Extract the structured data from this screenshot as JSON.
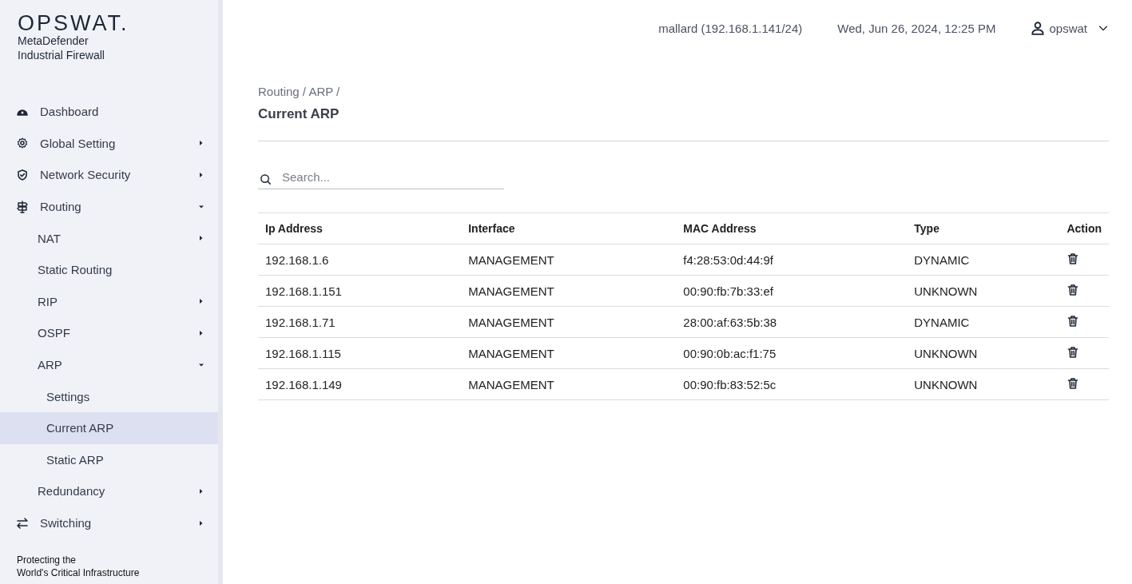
{
  "brand": {
    "logo": "OPSWAT.",
    "product": "MetaDefender",
    "subtitle": "Industrial Firewall"
  },
  "sidebar": {
    "items": [
      {
        "label": "Dashboard",
        "selected": false
      },
      {
        "label": "Global Setting",
        "selected": false,
        "expanded": false
      },
      {
        "label": "Network Security",
        "selected": false,
        "expanded": false
      },
      {
        "label": "Routing",
        "selected": false,
        "expanded": true,
        "children": [
          {
            "label": "NAT",
            "selected": false,
            "expanded": false
          },
          {
            "label": "Static Routing",
            "selected": false
          },
          {
            "label": "RIP",
            "selected": false,
            "expanded": false
          },
          {
            "label": "OSPF",
            "selected": false,
            "expanded": false
          },
          {
            "label": "ARP",
            "selected": false,
            "expanded": true,
            "children": [
              {
                "label": "Settings",
                "selected": false
              },
              {
                "label": "Current ARP",
                "selected": true
              },
              {
                "label": "Static ARP",
                "selected": false
              }
            ]
          },
          {
            "label": "Redundancy",
            "selected": false,
            "expanded": false
          }
        ]
      },
      {
        "label": "Switching",
        "selected": false,
        "expanded": false
      }
    ],
    "footer": [
      "Protecting the",
      "World's Critical Infrastructure"
    ]
  },
  "header": {
    "host": "mallard (192.168.1.141/24)",
    "datetime": "Wed, Jun 26, 2024, 12:25 PM",
    "user": "opswat"
  },
  "breadcrumb": "Routing / ARP /",
  "page_title": "Current ARP",
  "search": {
    "placeholder": "Search..."
  },
  "table": {
    "columns": [
      "Ip Address",
      "Interface",
      "MAC Address",
      "Type",
      "Action"
    ],
    "rows": [
      [
        "192.168.1.6",
        "MANAGEMENT",
        "f4:28:53:0d:44:9f",
        "DYNAMIC"
      ],
      [
        "192.168.1.151",
        "MANAGEMENT",
        "00:90:fb:7b:33:ef",
        "UNKNOWN"
      ],
      [
        "192.168.1.71",
        "MANAGEMENT",
        "28:00:af:63:5b:38",
        "DYNAMIC"
      ],
      [
        "192.168.1.115",
        "MANAGEMENT",
        "00:90:0b:ac:f1:75",
        "UNKNOWN"
      ],
      [
        "192.168.1.149",
        "MANAGEMENT",
        "00:90:fb:83:52:5c",
        "UNKNOWN"
      ]
    ]
  }
}
